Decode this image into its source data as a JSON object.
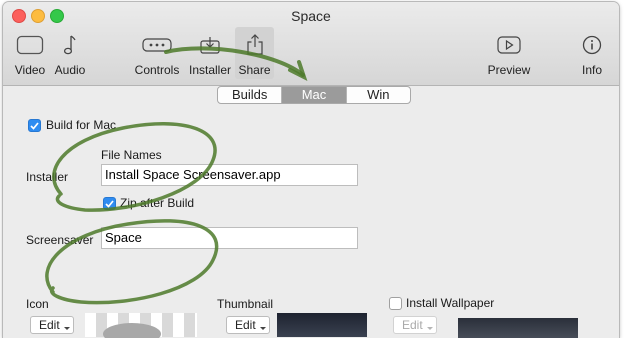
{
  "window": {
    "title": "Space"
  },
  "toolbar": {
    "video": "Video",
    "audio": "Audio",
    "controls": "Controls",
    "installer": "Installer",
    "share": "Share",
    "preview": "Preview",
    "info": "Info"
  },
  "tabs": {
    "builds": "Builds",
    "mac": "Mac",
    "win": "Win",
    "selected": "Mac"
  },
  "form": {
    "build_for_mac": {
      "label": "Build for Mac",
      "checked": true
    },
    "installer_label": "Installer",
    "file_names_label": "File Names",
    "installer_value": "Install Space Screensaver.app",
    "zip_after_build": {
      "label": "Zip after Build",
      "checked": true
    },
    "screensaver_label": "Screensaver",
    "screensaver_value": "Space",
    "icon_label": "Icon",
    "icon_edit": "Edit",
    "thumbnail_label": "Thumbnail",
    "thumbnail_edit": "Edit",
    "install_wallpaper": {
      "label": "Install Wallpaper",
      "checked": false
    },
    "wallpaper_edit": "Edit"
  },
  "colors": {
    "accent": "#2e8cf1",
    "annotation": "#4d7a2a"
  }
}
